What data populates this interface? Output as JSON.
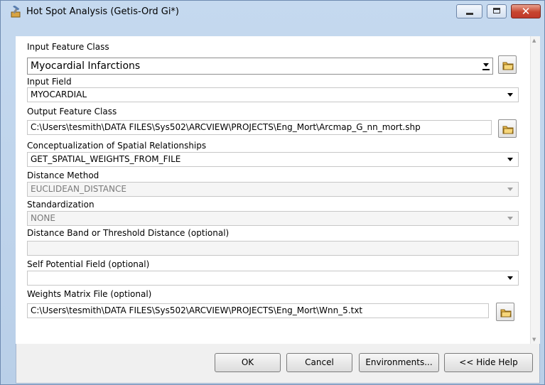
{
  "window": {
    "title": "Hot Spot Analysis (Getis-Ord Gi*)",
    "icon": "toolbox-hammer-icon",
    "controls": {
      "minimize": "minimize-icon",
      "maximize": "maximize-icon",
      "close": "close-icon",
      "close_glyph": "✕"
    }
  },
  "form": {
    "input_feature_class": {
      "label": "Input Feature Class",
      "value": "Myocardial Infarctions"
    },
    "input_field": {
      "label": "Input Field",
      "value": "MYOCARDIAL"
    },
    "output_feature_class": {
      "label": "Output Feature Class",
      "value": "C:\\Users\\tesmith\\DATA FILES\\Sys502\\ARCVIEW\\PROJECTS\\Eng_Mort\\Arcmap_G_nn_mort.shp"
    },
    "conceptualization": {
      "label": "Conceptualization of Spatial Relationships",
      "value": "GET_SPATIAL_WEIGHTS_FROM_FILE"
    },
    "distance_method": {
      "label": "Distance Method",
      "value": "EUCLIDEAN_DISTANCE"
    },
    "standardization": {
      "label": "Standardization",
      "value": "NONE"
    },
    "distance_band": {
      "label": "Distance Band or Threshold Distance (optional)",
      "value": ""
    },
    "self_potential_field": {
      "label": "Self Potential Field (optional)",
      "value": ""
    },
    "weights_matrix_file": {
      "label": "Weights Matrix File (optional)",
      "value": "C:\\Users\\tesmith\\DATA FILES\\Sys502\\ARCVIEW\\PROJECTS\\Eng_Mort\\Wnn_5.txt"
    }
  },
  "buttons": {
    "ok": "OK",
    "cancel": "Cancel",
    "environments": "Environments...",
    "hide_help": "<< Hide Help"
  },
  "colors": {
    "title_bar": "#c5d9ef",
    "close_button": "#c7452f",
    "folder_icon": "#e8b84a"
  }
}
